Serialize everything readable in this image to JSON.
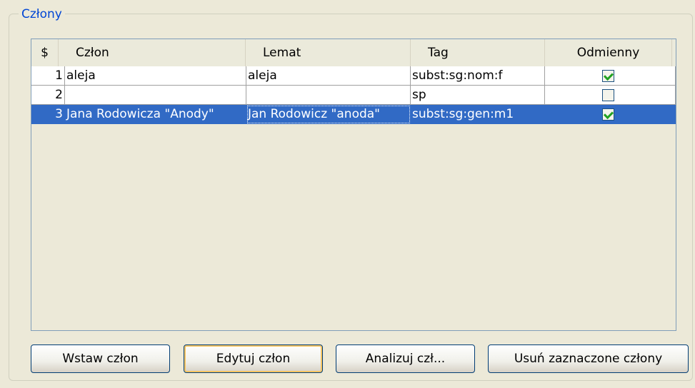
{
  "group": {
    "title": "Człony"
  },
  "table": {
    "columns": [
      "$",
      "Człon",
      "Lemat",
      "Tag",
      "Odmienny"
    ],
    "rows": [
      {
        "num": "1",
        "czlon": "aleja",
        "lemat": "aleja",
        "tag": "subst:sg:nom:f",
        "odmienny": true,
        "selected": false
      },
      {
        "num": "2",
        "czlon": "",
        "lemat": "",
        "tag": "sp",
        "odmienny": false,
        "selected": false
      },
      {
        "num": "3",
        "czlon": "Jana Rodowicza \"Anody\"",
        "lemat": "Jan Rodowicz \"anoda\"",
        "tag": "subst:sg:gen:m1",
        "odmienny": true,
        "selected": true
      }
    ]
  },
  "buttons": {
    "insert": "Wstaw człon",
    "edit": "Edytuj człon",
    "analyze": "Analizuj czł...",
    "delete": "Usuń zaznaczone człony"
  }
}
